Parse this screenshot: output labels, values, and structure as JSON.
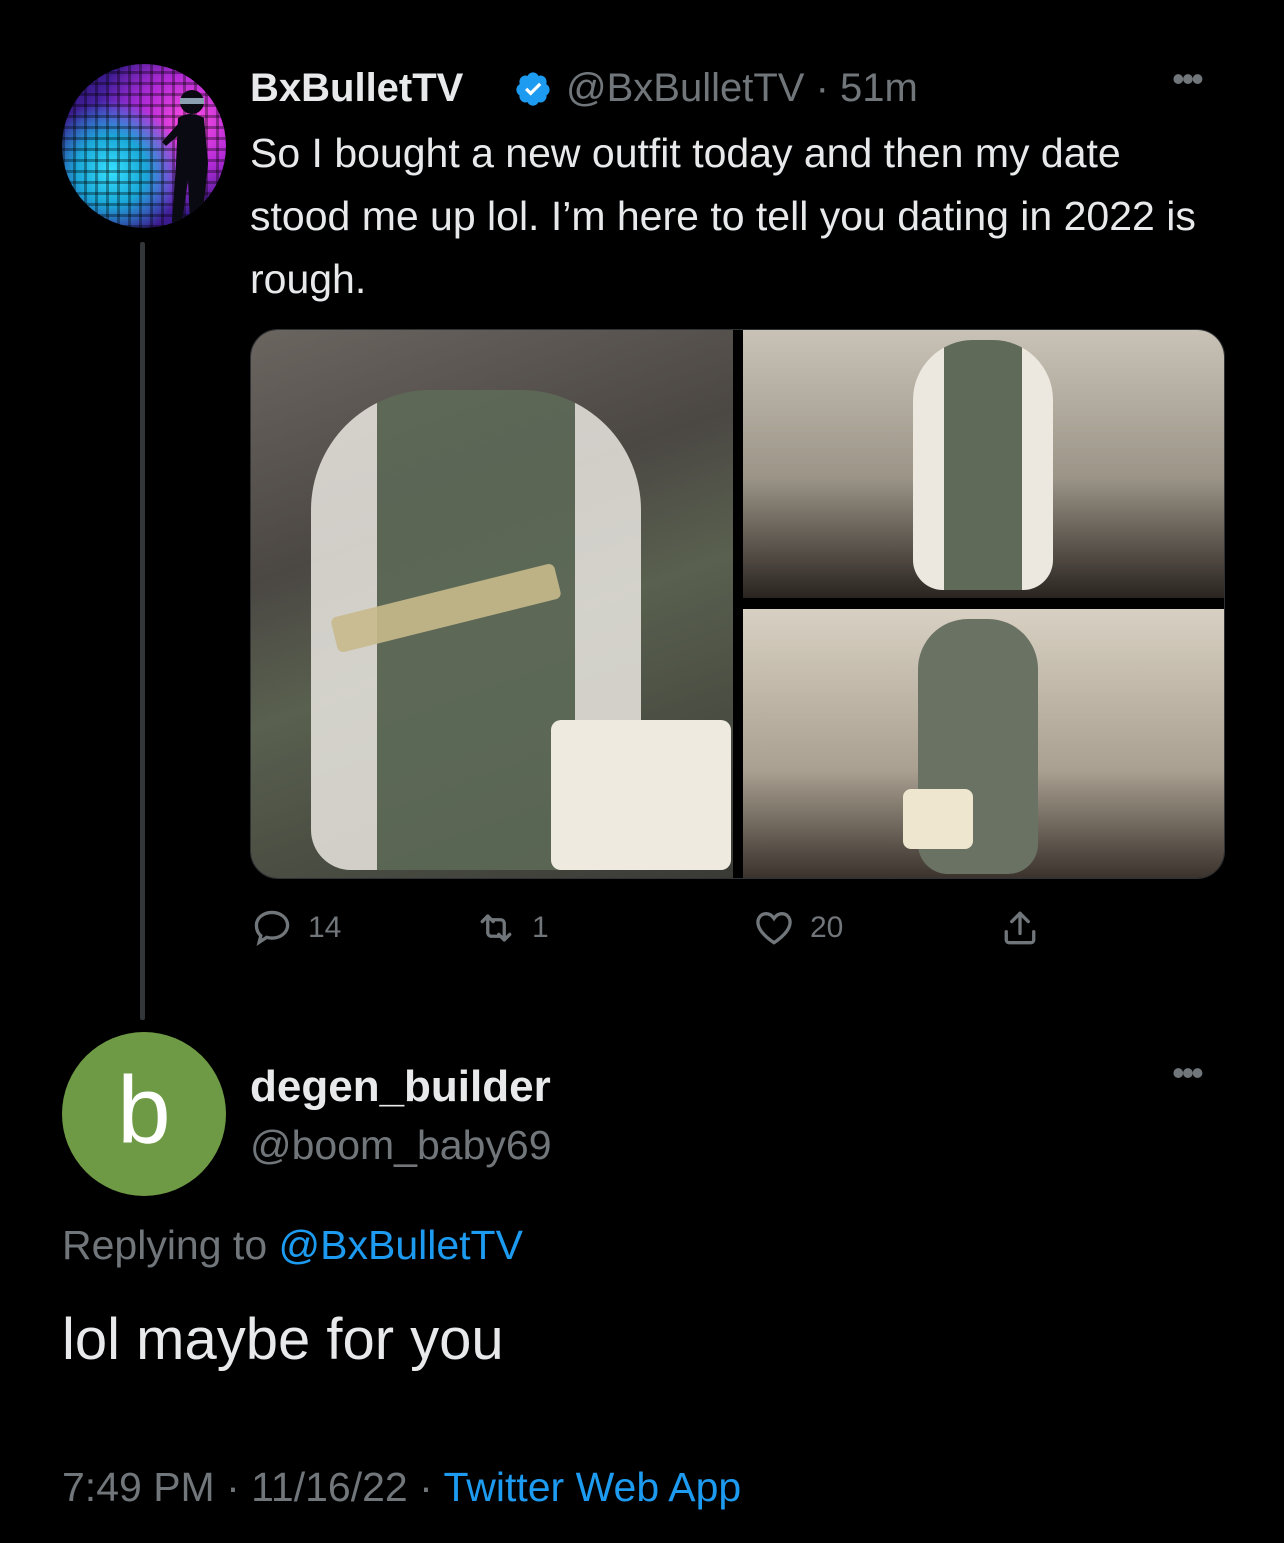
{
  "parent_tweet": {
    "display_name": "BxBulletTV",
    "handle": "@BxBulletTV",
    "separator": "·",
    "age": "51m",
    "text": "So I bought a new outfit today and then my date stood me up lol. I’m here to tell you dating in 2022 is rough.",
    "verified": true,
    "replies": "14",
    "retweets": "1",
    "likes": "20"
  },
  "reply_tweet": {
    "avatar_letter": "b",
    "avatar_color": "#6f9a45",
    "display_name": "degen_builder",
    "handle": "@boom_baby69",
    "replying_prefix": "Replying to",
    "replying_to": "@BxBulletTV",
    "text": "lol maybe for you",
    "time": "7:49 PM",
    "date": "11/16/22",
    "separator": "·",
    "source": "Twitter Web App"
  },
  "more_glyph": "•••",
  "colors": {
    "background": "#000000",
    "text": "#e7e9ea",
    "muted": "#71767b",
    "link": "#1d9bf0",
    "verified": "#1d9bf0"
  }
}
